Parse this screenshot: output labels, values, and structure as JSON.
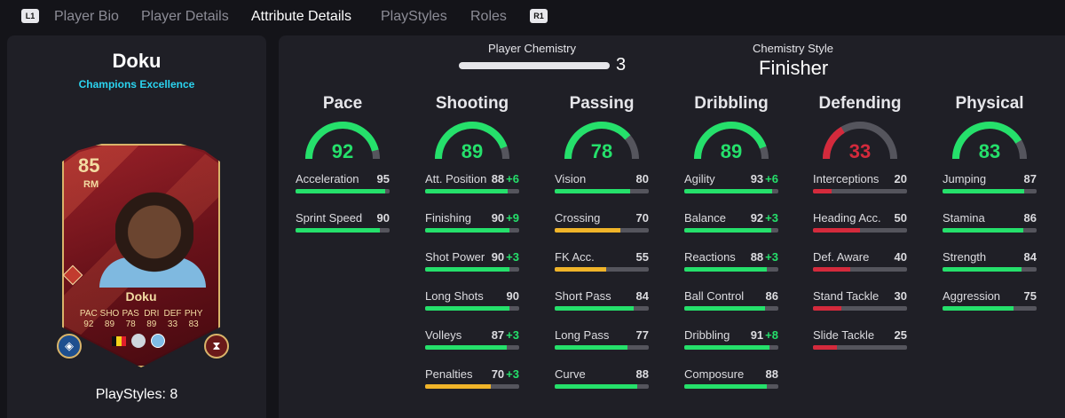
{
  "nav": {
    "left_button": "L1",
    "right_button": "R1",
    "tabs": [
      "Player Bio",
      "Player Details",
      "Attribute Details",
      "PlayStyles",
      "Roles"
    ],
    "active_tab": "Attribute Details"
  },
  "player": {
    "name": "Doku",
    "card_type": "Champions Excellence",
    "playstyles_label": "PlayStyles: 8"
  },
  "card": {
    "overall": "85",
    "position": "RM",
    "name": "Doku",
    "stat_labels": [
      "PAC",
      "SHO",
      "PAS",
      "DRI",
      "DEF",
      "PHY"
    ],
    "stat_values": [
      "92",
      "89",
      "78",
      "89",
      "33",
      "83"
    ]
  },
  "chemistry": {
    "label": "Player Chemistry",
    "value": "3",
    "style_label": "Chemistry Style",
    "style_value": "Finisher"
  },
  "colors": {
    "green": "#25e06b",
    "yellow": "#f0b429",
    "red": "#d42a3c",
    "gauge_track": "#55555d"
  },
  "categories": [
    {
      "title": "Pace",
      "value": 92,
      "color": "#25e06b",
      "attrs": [
        {
          "name": "Acceleration",
          "value": "95",
          "boost": "",
          "level": 95,
          "color": "#25e06b"
        },
        {
          "name": "Sprint Speed",
          "value": "90",
          "boost": "",
          "level": 90,
          "color": "#25e06b"
        }
      ]
    },
    {
      "title": "Shooting",
      "value": 89,
      "color": "#25e06b",
      "attrs": [
        {
          "name": "Att. Position",
          "value": "88",
          "boost": "+6",
          "level": 88,
          "color": "#25e06b"
        },
        {
          "name": "Finishing",
          "value": "90",
          "boost": "+9",
          "level": 90,
          "color": "#25e06b"
        },
        {
          "name": "Shot Power",
          "value": "90",
          "boost": "+3",
          "level": 90,
          "color": "#25e06b"
        },
        {
          "name": "Long Shots",
          "value": "90",
          "boost": "",
          "level": 90,
          "color": "#25e06b"
        },
        {
          "name": "Volleys",
          "value": "87",
          "boost": "+3",
          "level": 87,
          "color": "#25e06b"
        },
        {
          "name": "Penalties",
          "value": "70",
          "boost": "+3",
          "level": 70,
          "color": "#f0b429"
        }
      ]
    },
    {
      "title": "Passing",
      "value": 78,
      "color": "#25e06b",
      "attrs": [
        {
          "name": "Vision",
          "value": "80",
          "boost": "",
          "level": 80,
          "color": "#25e06b"
        },
        {
          "name": "Crossing",
          "value": "70",
          "boost": "",
          "level": 70,
          "color": "#f0b429"
        },
        {
          "name": "FK Acc.",
          "value": "55",
          "boost": "",
          "level": 55,
          "color": "#f0b429"
        },
        {
          "name": "Short Pass",
          "value": "84",
          "boost": "",
          "level": 84,
          "color": "#25e06b"
        },
        {
          "name": "Long Pass",
          "value": "77",
          "boost": "",
          "level": 77,
          "color": "#25e06b"
        },
        {
          "name": "Curve",
          "value": "88",
          "boost": "",
          "level": 88,
          "color": "#25e06b"
        }
      ]
    },
    {
      "title": "Dribbling",
      "value": 89,
      "color": "#25e06b",
      "attrs": [
        {
          "name": "Agility",
          "value": "93",
          "boost": "+6",
          "level": 93,
          "color": "#25e06b"
        },
        {
          "name": "Balance",
          "value": "92",
          "boost": "+3",
          "level": 92,
          "color": "#25e06b"
        },
        {
          "name": "Reactions",
          "value": "88",
          "boost": "+3",
          "level": 88,
          "color": "#25e06b"
        },
        {
          "name": "Ball Control",
          "value": "86",
          "boost": "",
          "level": 86,
          "color": "#25e06b"
        },
        {
          "name": "Dribbling",
          "value": "91",
          "boost": "+8",
          "level": 91,
          "color": "#25e06b"
        },
        {
          "name": "Composure",
          "value": "88",
          "boost": "",
          "level": 88,
          "color": "#25e06b"
        }
      ]
    },
    {
      "title": "Defending",
      "value": 33,
      "color": "#d42a3c",
      "attrs": [
        {
          "name": "Interceptions",
          "value": "20",
          "boost": "",
          "level": 20,
          "color": "#d42a3c"
        },
        {
          "name": "Heading Acc.",
          "value": "50",
          "boost": "",
          "level": 50,
          "color": "#d42a3c"
        },
        {
          "name": "Def. Aware",
          "value": "40",
          "boost": "",
          "level": 40,
          "color": "#d42a3c"
        },
        {
          "name": "Stand Tackle",
          "value": "30",
          "boost": "",
          "level": 30,
          "color": "#d42a3c"
        },
        {
          "name": "Slide Tackle",
          "value": "25",
          "boost": "",
          "level": 25,
          "color": "#d42a3c"
        }
      ]
    },
    {
      "title": "Physical",
      "value": 83,
      "color": "#25e06b",
      "attrs": [
        {
          "name": "Jumping",
          "value": "87",
          "boost": "",
          "level": 87,
          "color": "#25e06b"
        },
        {
          "name": "Stamina",
          "value": "86",
          "boost": "",
          "level": 86,
          "color": "#25e06b"
        },
        {
          "name": "Strength",
          "value": "84",
          "boost": "",
          "level": 84,
          "color": "#25e06b"
        },
        {
          "name": "Aggression",
          "value": "75",
          "boost": "",
          "level": 75,
          "color": "#25e06b"
        }
      ]
    }
  ]
}
